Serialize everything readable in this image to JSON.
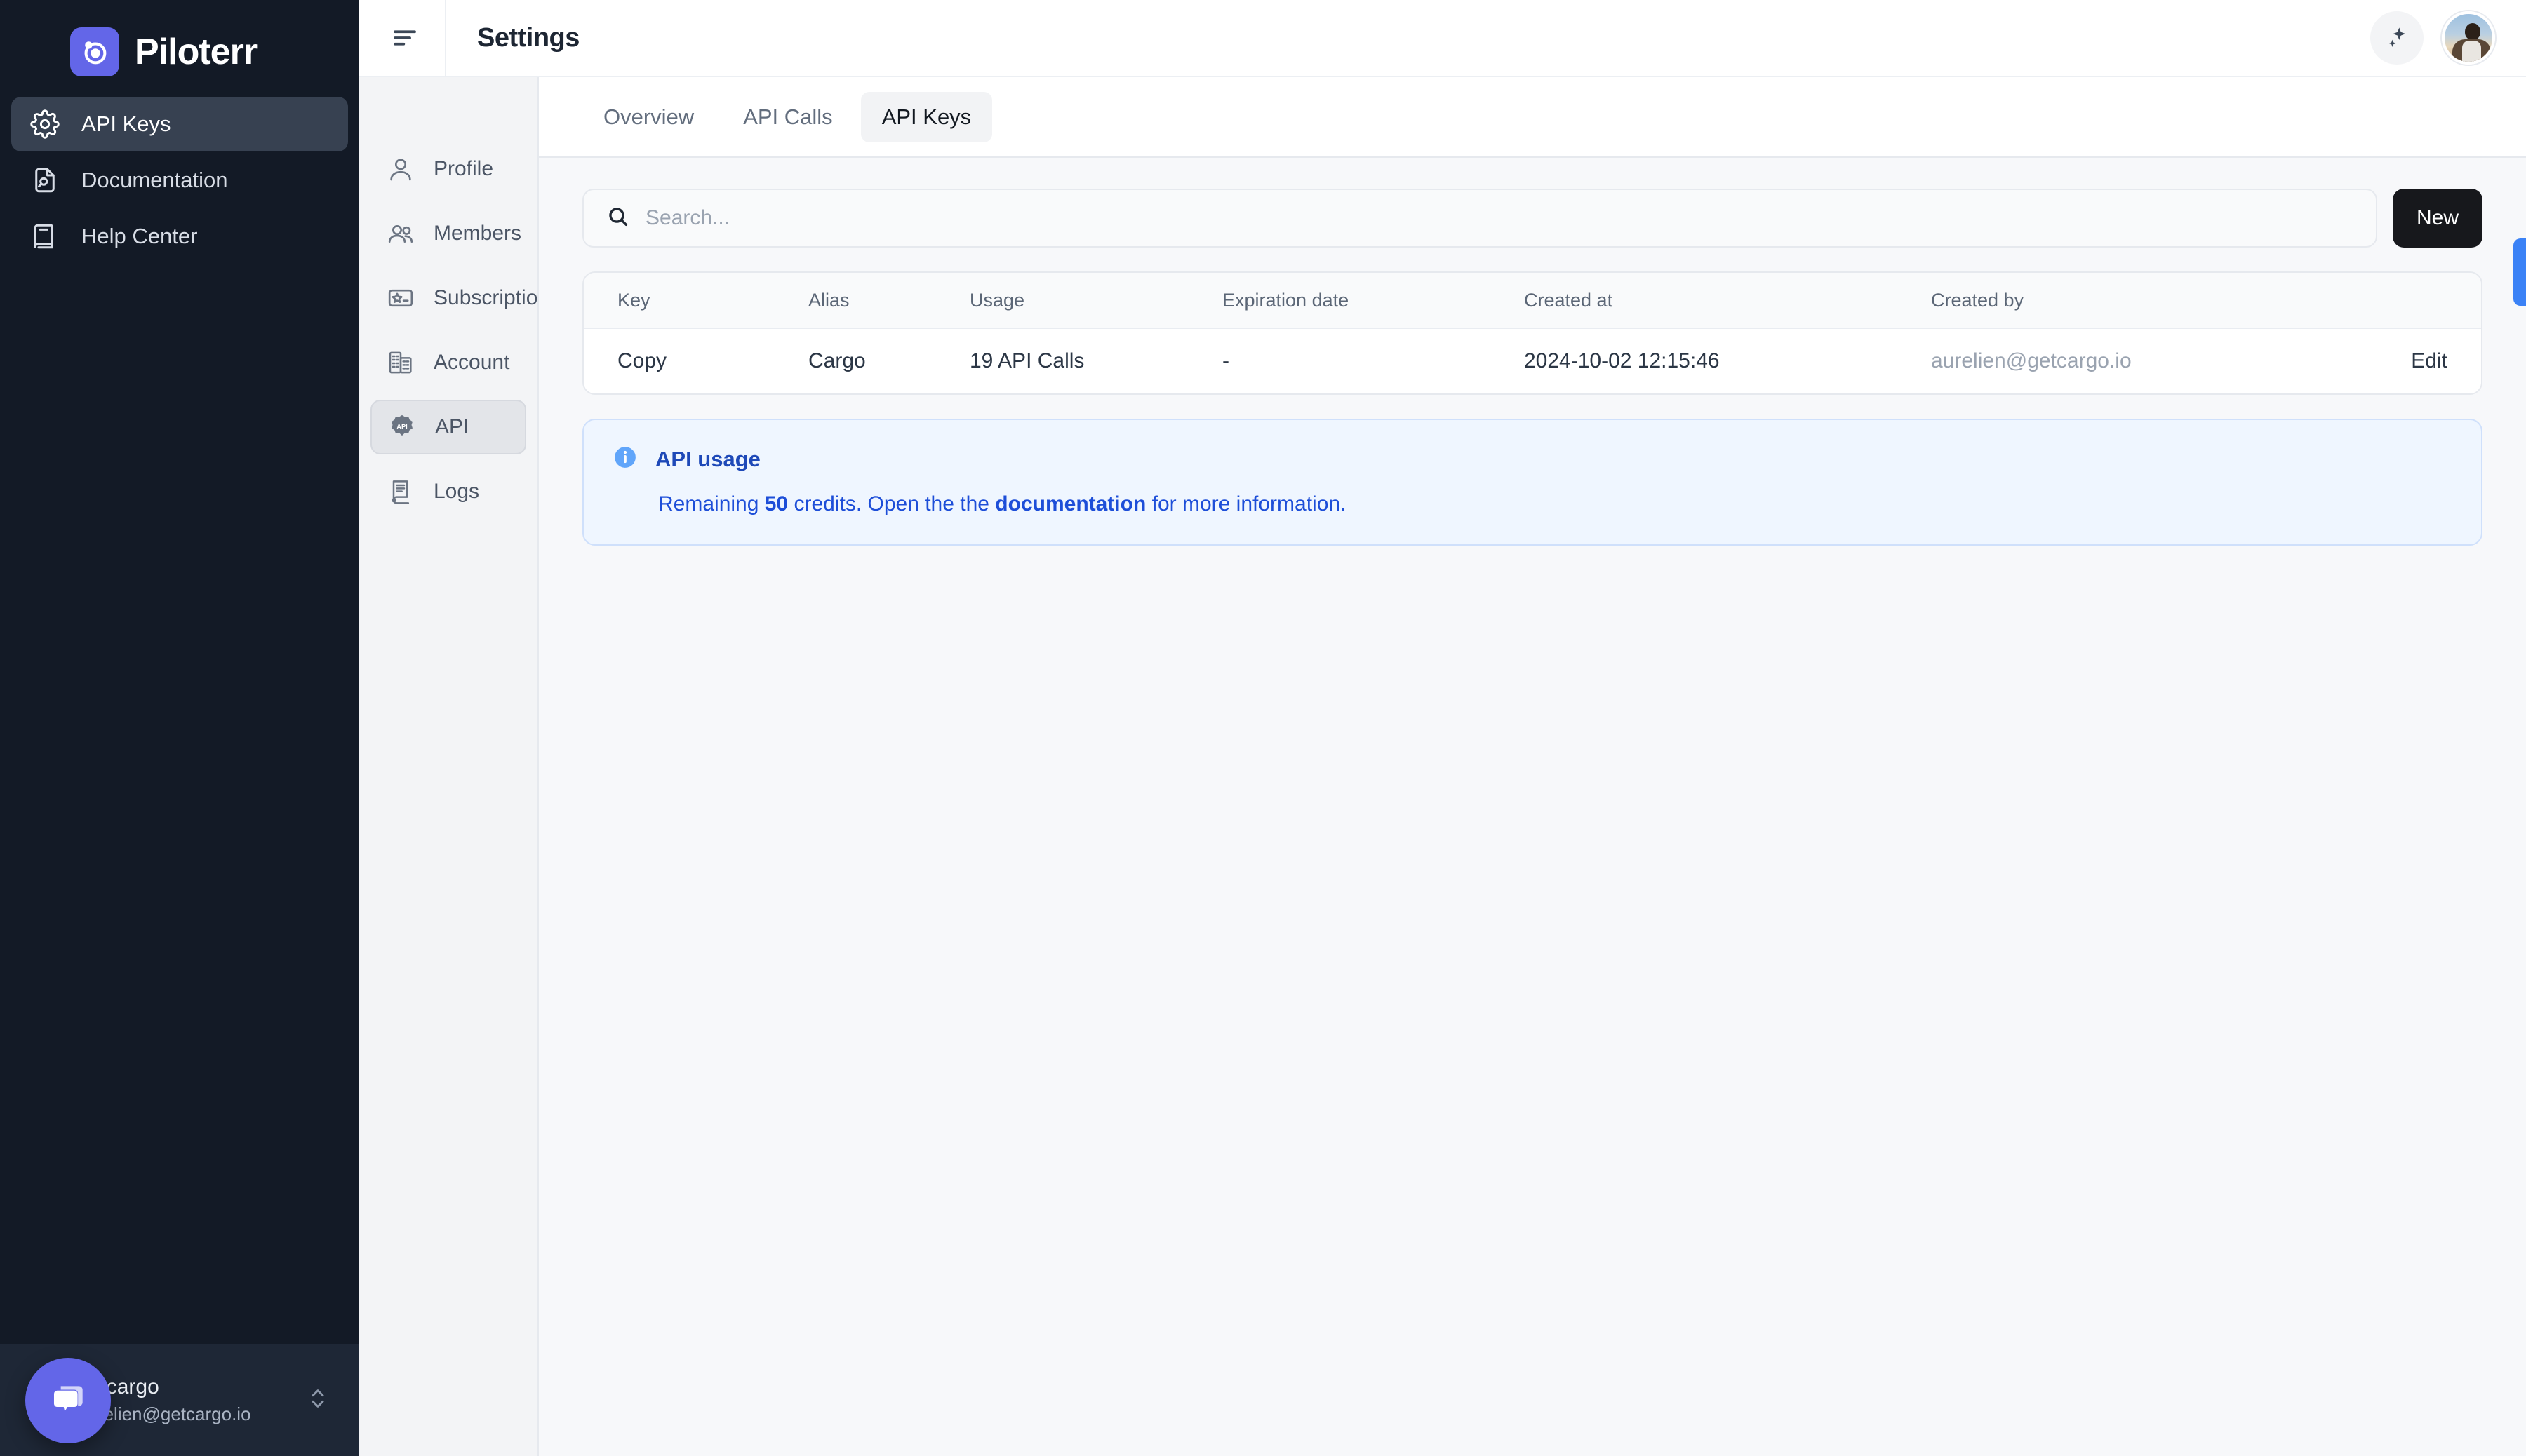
{
  "brand": {
    "name": "Piloterr",
    "logo_icon": "piloterr-logo-icon",
    "accent": "#6366e8"
  },
  "sidebar": {
    "items": [
      {
        "label": "API Keys",
        "icon": "gear-icon",
        "active": true
      },
      {
        "label": "Documentation",
        "icon": "document-search-icon",
        "active": false
      },
      {
        "label": "Help Center",
        "icon": "book-icon",
        "active": false
      }
    ],
    "account": {
      "name": "getcargo",
      "email": "aurelien@getcargo.io",
      "switcher_icon": "chevron-up-down-icon"
    },
    "chat_widget_icon": "chat-bubble-icon",
    "bg": "#131a26",
    "active_bg": "#374151"
  },
  "topbar": {
    "menu_icon": "hamburger-menu-icon",
    "title": "Settings",
    "sparkle_icon": "sparkles-icon",
    "avatar_icon": "user-avatar"
  },
  "settings_nav": {
    "items": [
      {
        "label": "Profile",
        "icon": "user-icon",
        "active": false
      },
      {
        "label": "Members",
        "icon": "users-icon",
        "active": false
      },
      {
        "label": "Subscription",
        "icon": "star-card-icon",
        "active": false
      },
      {
        "label": "Account",
        "icon": "building-icon",
        "active": false
      },
      {
        "label": "API",
        "icon": "api-badge-icon",
        "active": true
      },
      {
        "label": "Logs",
        "icon": "scroll-icon",
        "active": false
      }
    ]
  },
  "tabs": [
    {
      "label": "Overview",
      "active": false
    },
    {
      "label": "API Calls",
      "active": false
    },
    {
      "label": "API Keys",
      "active": true
    }
  ],
  "search": {
    "placeholder": "Search...",
    "value": "",
    "icon": "search-icon"
  },
  "new_button": {
    "label": "New"
  },
  "table": {
    "columns": [
      "Key",
      "Alias",
      "Usage",
      "Expiration date",
      "Created at",
      "Created by",
      ""
    ],
    "rows": [
      {
        "key": "Copy",
        "alias": "Cargo",
        "usage": "19 API Calls",
        "expiration_date": "-",
        "created_at": "2024-10-02 12:15:46",
        "created_by": "aurelien@getcargo.io",
        "action": "Edit"
      }
    ]
  },
  "notice": {
    "icon": "info-icon",
    "title": "API usage",
    "text_before": "Remaining ",
    "credits": "50",
    "text_middle": " credits. Open the the ",
    "link": "documentation",
    "text_after": " for more information.",
    "accent": "#1d4ed8",
    "bg": "#eff6ff"
  },
  "edge_tab": {
    "name": "feedback-tab",
    "color": "#3b82f6"
  }
}
